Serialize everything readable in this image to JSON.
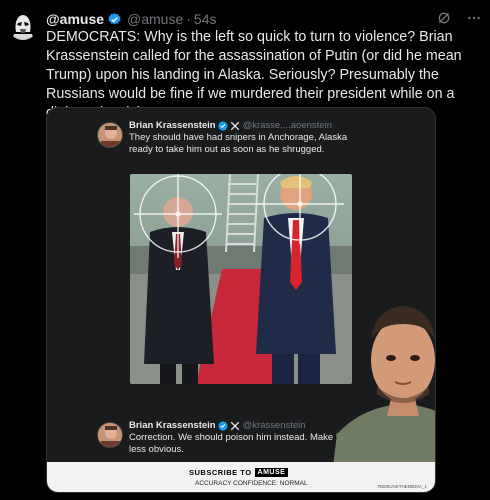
{
  "post": {
    "display_name": "@amuse",
    "handle": "@amuse",
    "separator": "·",
    "time": "54s",
    "text": "DEMOCRATS: Why is the left so quick to turn to violence? Brian Krassenstein called for the assassination of Putin (or did he mean Trump) upon his landing in Alaska. Seriously? Presumably the Russians would be fine if we murdered their president while on a diplomatic mision.",
    "icons": {
      "avatar": "stormtrooper-avatar",
      "verified": "verified-badge-icon",
      "grok": "grok-icon",
      "more": "more-icon"
    }
  },
  "media": {
    "tweet1": {
      "name": "Brian Krassenstein",
      "handle": "@krasse....aoenstein",
      "text": "They should have had snipers in Anchorage, Alaska ready to take him out as soon as he shrugged."
    },
    "tweet2": {
      "name": "Brian Krassenstein",
      "handle": "@krassenstein",
      "text": "Correction.  We should poison him instead. Make it less obvious."
    },
    "subscribe": {
      "label": "SUBSCRIBE TO",
      "brand": "AMUSE",
      "confidence": "ACCURACY CONFIDENCE: NORMAL",
      "code": "#DEBUNKTHEMEDIA_1"
    },
    "colors": {
      "verified": "#1d9bf0",
      "carpet": "#c8283a",
      "tie": "#d9232e"
    }
  }
}
